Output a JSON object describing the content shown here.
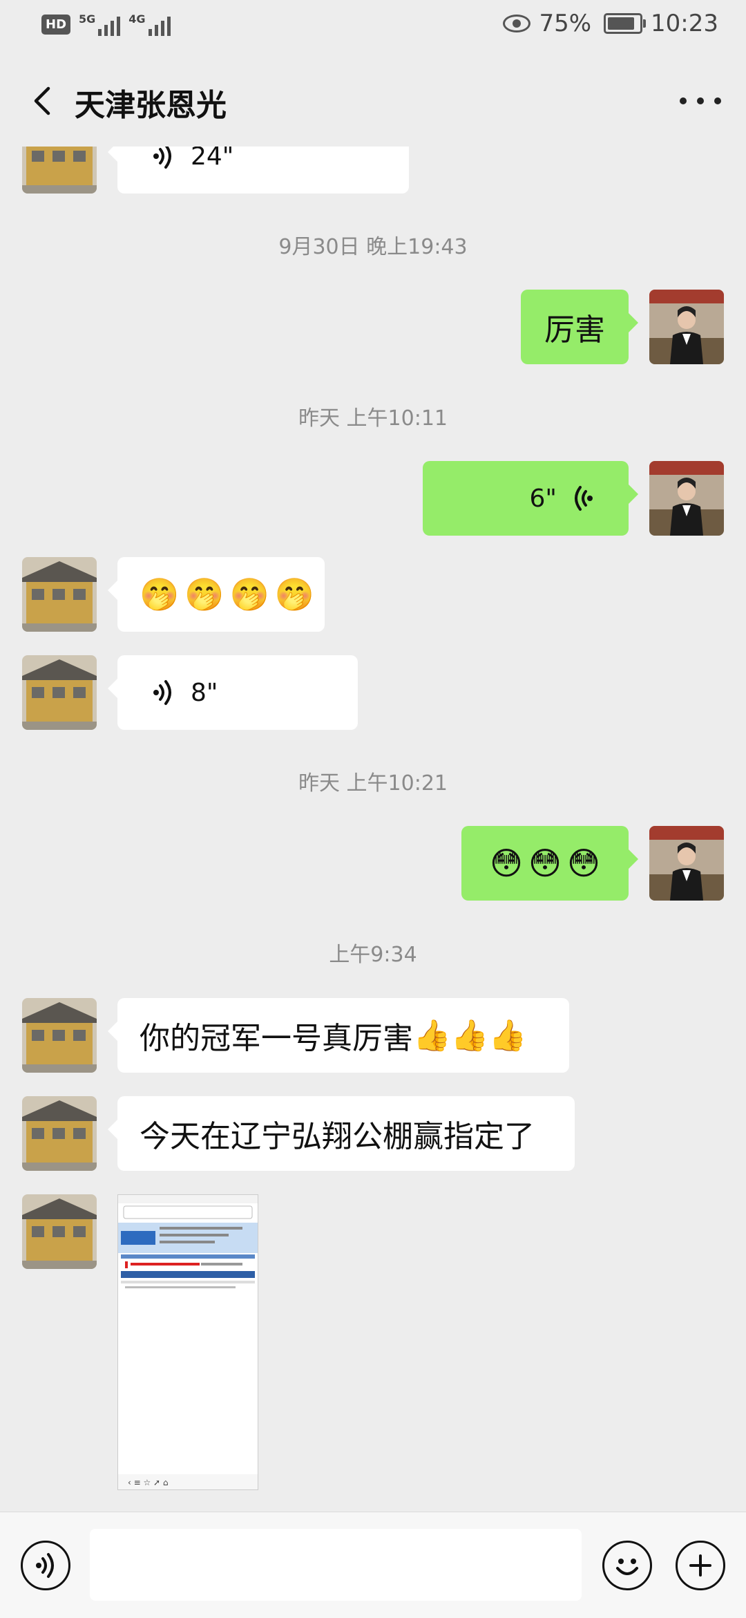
{
  "status_bar": {
    "hd": "HD",
    "sim1": "5G",
    "sim2": "4G",
    "battery": "75%",
    "time": "10:23"
  },
  "header": {
    "title": "天津张恩光"
  },
  "messages": [
    {
      "type": "voice",
      "direction": "in",
      "duration": "24\""
    },
    {
      "type": "timestamp",
      "text": "9月30日 晚上19:43"
    },
    {
      "type": "text",
      "direction": "out",
      "text": "厉害"
    },
    {
      "type": "timestamp",
      "text": "昨天 上午10:11"
    },
    {
      "type": "voice",
      "direction": "out",
      "duration": "6\""
    },
    {
      "type": "emoji",
      "direction": "in",
      "emojis": [
        "🤭",
        "🤭",
        "🤭",
        "🤭"
      ]
    },
    {
      "type": "voice",
      "direction": "in",
      "duration": "8\""
    },
    {
      "type": "timestamp",
      "text": "昨天 上午10:21"
    },
    {
      "type": "emoji",
      "direction": "out",
      "emojis": [
        "😳",
        "😳",
        "😳"
      ]
    },
    {
      "type": "timestamp",
      "text": "上午9:34"
    },
    {
      "type": "text",
      "direction": "in",
      "text": "你的冠军一号真厉害",
      "trailing": [
        "👍",
        "👍",
        "👍"
      ]
    },
    {
      "type": "text",
      "direction": "in",
      "text": "今天在辽宁弘翔公棚赢指定了"
    },
    {
      "type": "image",
      "direction": "in",
      "content": "phone-screenshot"
    }
  ],
  "colors": {
    "background": "#ededed",
    "outgoing_bubble": "#95ec69",
    "incoming_bubble": "#ffffff",
    "timestamp_text": "#8a8a8a"
  },
  "icons": {
    "back": "chevron-left-icon",
    "more": "more-dots-icon",
    "voice_input": "voice-icon",
    "emoji": "emoji-icon",
    "plus": "plus-icon"
  }
}
